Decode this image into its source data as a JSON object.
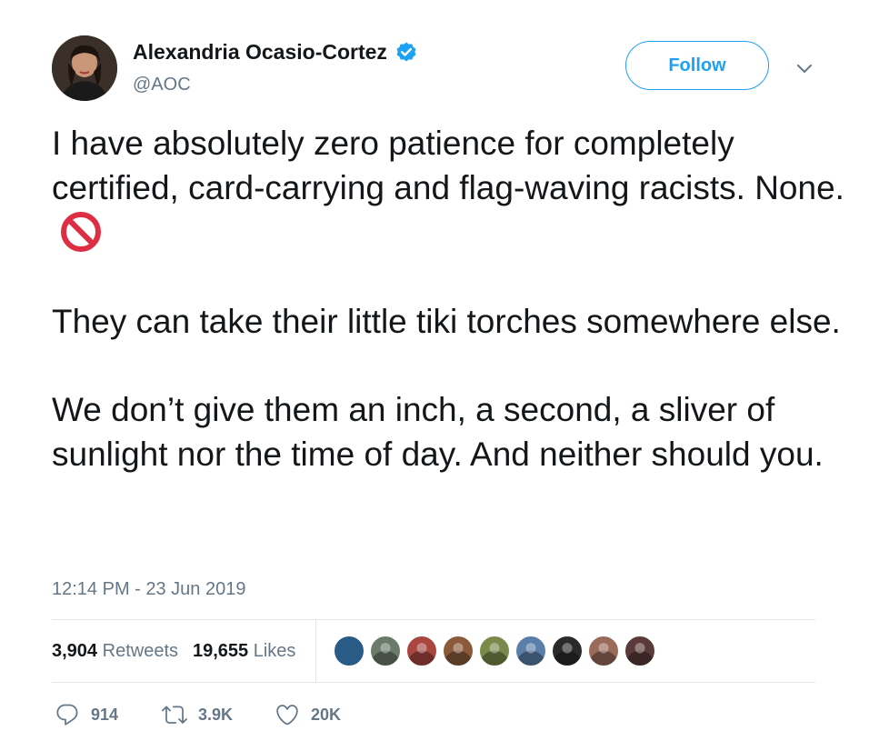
{
  "author": {
    "name": "Alexandria Ocasio-Cortez",
    "handle": "@AOC",
    "verified": true
  },
  "follow_button": {
    "label": "Follow"
  },
  "tweet": {
    "lines": {
      "p1": "I have absolutely zero patience for completely certified, card-carrying and flag-waving racists. None.",
      "p2": "They can take their little tiki torches somewhere else.",
      "p3": "We don’t give them an inch, a second, a sliver of sunlight nor the time of day. And neither should you."
    },
    "emoji": "prohibited-icon",
    "timestamp": "12:14 PM - 23 Jun 2019"
  },
  "stats": {
    "retweets_count": "3,904",
    "retweets_label": "Retweets",
    "likes_count": "19,655",
    "likes_label": "Likes"
  },
  "likers": [
    {
      "color": "#2a5a86"
    },
    {
      "color": "#6b7b6a"
    },
    {
      "color": "#a8463f"
    },
    {
      "color": "#8a5a3a"
    },
    {
      "color": "#7a8a4a"
    },
    {
      "color": "#5a7fa8"
    },
    {
      "color": "#2a2a2a"
    },
    {
      "color": "#9a6a5a"
    },
    {
      "color": "#5a3a3a"
    }
  ],
  "actions": {
    "replies": "914",
    "retweets": "3.9K",
    "likes": "20K"
  },
  "colors": {
    "accent": "#1da1f2",
    "secondary_text": "#657786",
    "prohibited_red": "#dd2e44"
  }
}
